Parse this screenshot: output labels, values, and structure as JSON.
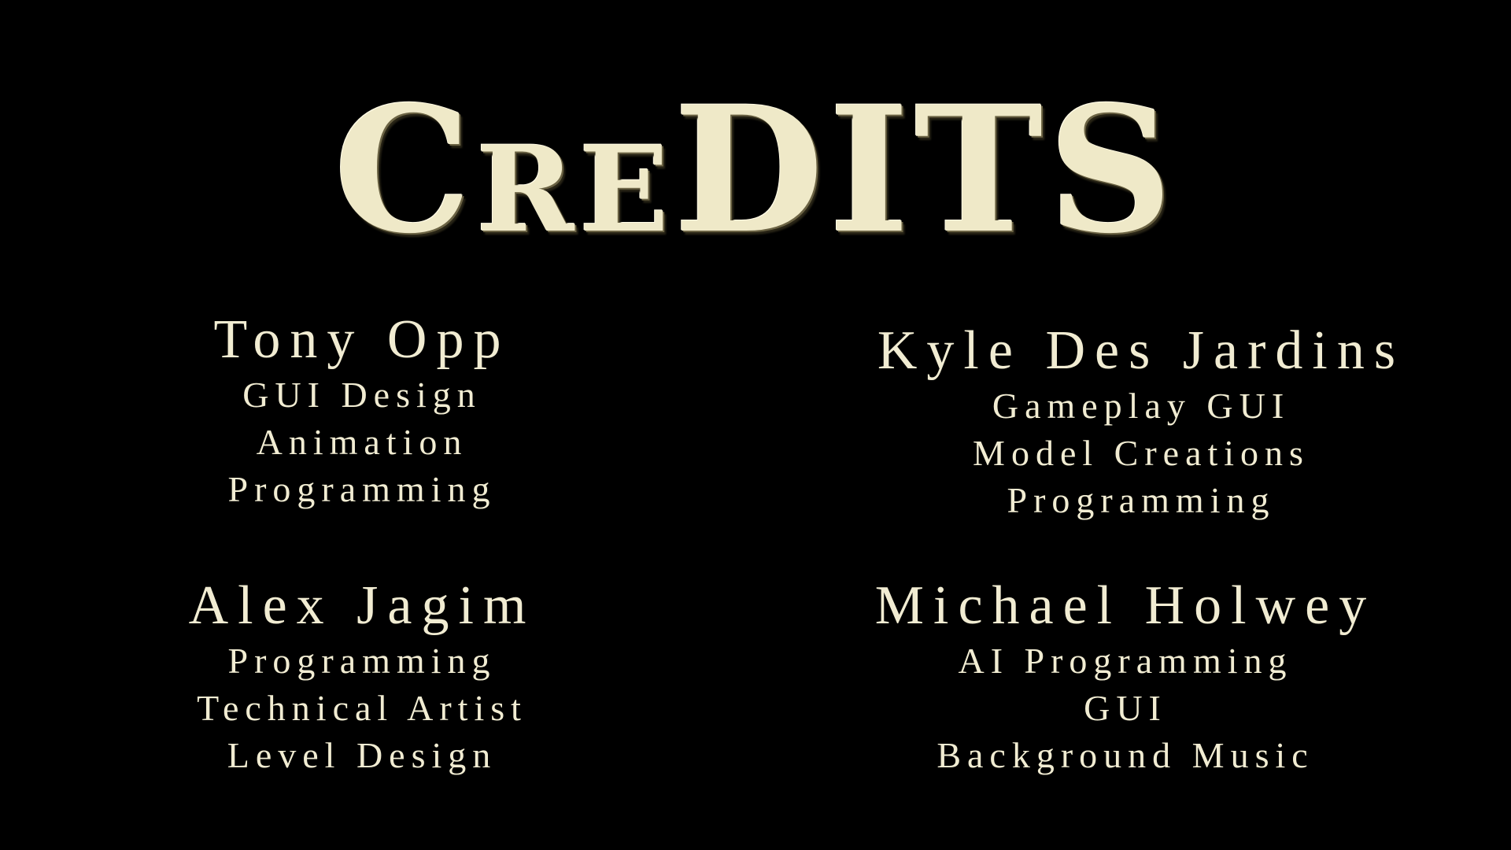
{
  "title": {
    "text": "CREDITS",
    "letters": [
      "C",
      "R",
      "E",
      "D",
      "I",
      "T",
      "S"
    ]
  },
  "credits": [
    {
      "name": "Tony Opp",
      "roles": [
        "GUI Design",
        "Animation",
        "Programming"
      ]
    },
    {
      "name": "Kyle Des Jardins",
      "roles": [
        "Gameplay GUI",
        "Model Creations",
        "Programming"
      ]
    },
    {
      "name": "Alex Jagim",
      "roles": [
        "Programming",
        "Technical Artist",
        "Level Design"
      ]
    },
    {
      "name": "Michael Holwey",
      "roles": [
        "AI Programming",
        "GUI",
        "Background Music"
      ]
    }
  ],
  "colors": {
    "background": "#000000",
    "text": "#f1ecd2",
    "title": "#efe9c8"
  }
}
